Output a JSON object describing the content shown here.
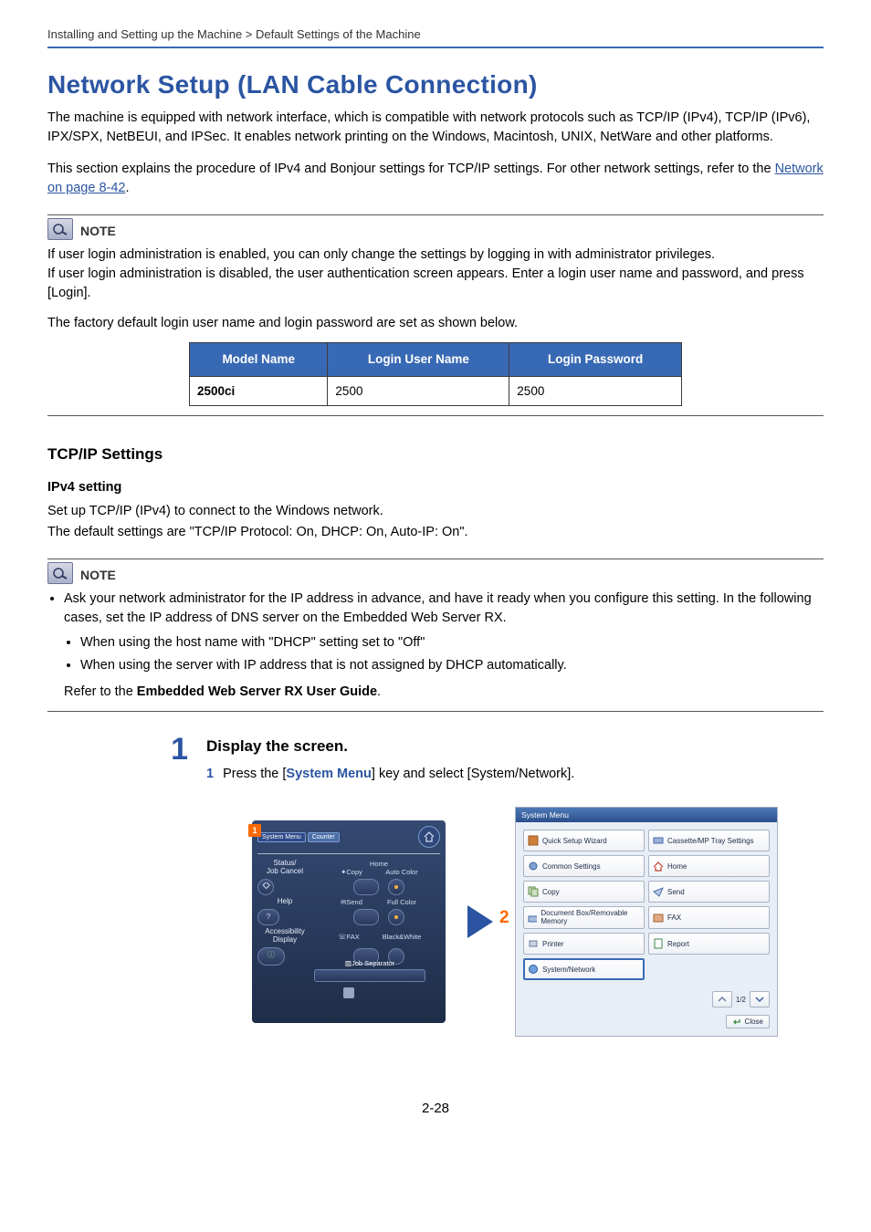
{
  "breadcrumb": "Installing and Setting up the Machine > Default Settings of the Machine",
  "title": "Network Setup (LAN Cable Connection)",
  "intro_1": "The machine is equipped with network interface, which is compatible with network protocols such as TCP/IP (IPv4), TCP/IP (IPv6), IPX/SPX, NetBEUI, and IPSec. It enables network printing on the Windows, Macintosh, UNIX, NetWare and other platforms.",
  "intro_2a": "This section explains the procedure of IPv4 and Bonjour settings for TCP/IP settings. For other network settings, refer to the ",
  "intro_2_link": "Network on page 8-42",
  "intro_2b": ".",
  "note_label": "NOTE",
  "note1_l1": "If user login administration is enabled, you can only change the settings by logging in with administrator privileges.",
  "note1_l2": "If user login administration is disabled, the user authentication screen appears. Enter a login user name and password, and press [Login].",
  "note1_l3": "The factory default login user name and login password are set as shown below.",
  "table": {
    "headers": [
      "Model Name",
      "Login User Name",
      "Login Password"
    ],
    "row": [
      "2500ci",
      "2500",
      "2500"
    ]
  },
  "section_tcpip": "TCP/IP Settings",
  "subsection_ipv4": "IPv4 setting",
  "ipv4_l1": "Set up TCP/IP (IPv4) to connect to the Windows network.",
  "ipv4_l2": "The default settings are \"TCP/IP Protocol: On, DHCP: On, Auto-IP: On\".",
  "note2_b1": "Ask your network administrator for the IP address in advance, and have it ready when you configure this setting. In the following cases, set the IP address of DNS server on the Embedded Web Server RX.",
  "note2_s1": "When using the host name with \"DHCP\" setting set to \"Off\"",
  "note2_s2": "When using the         server with IP address that is not assigned by DHCP automatically.",
  "note2_refer_a": "Refer to the ",
  "note2_refer_b": "Embedded Web Server RX User Guide",
  "note2_refer_c": ".",
  "step1_num": "1",
  "step1_title": "Display the screen.",
  "step1_sub1_a": "Press the [",
  "step1_sub1_b": "System Menu",
  "step1_sub1_c": "] key and select [System/Network].",
  "panel": {
    "callout": "1",
    "tab1": "System Menu",
    "tab2": "Counter",
    "r1_lbl": "Status/\nJob Cancel",
    "r1_b": "Home",
    "r1_c1": "Copy",
    "r1_c2": "Auto Color",
    "r2_lbl": "Help",
    "r2_c1": "Send",
    "r2_c2": "Full Color",
    "r3_lbl": "Accessibility\nDisplay",
    "r3_c1": "FAX",
    "r3_c2": "Black&White",
    "sep": "Job Separator"
  },
  "screenshot": {
    "title": "System Menu",
    "items_left": [
      "Quick Setup Wizard",
      "Common Settings",
      "Copy",
      "Document Box/Removable Memory",
      "Printer",
      "System/Network"
    ],
    "items_right": [
      "Cassette/MP Tray Settings",
      "Home",
      "Send",
      "FAX",
      "Report"
    ],
    "pager": "1/2",
    "close": "Close",
    "callout": "2"
  },
  "page_number": "2-28"
}
